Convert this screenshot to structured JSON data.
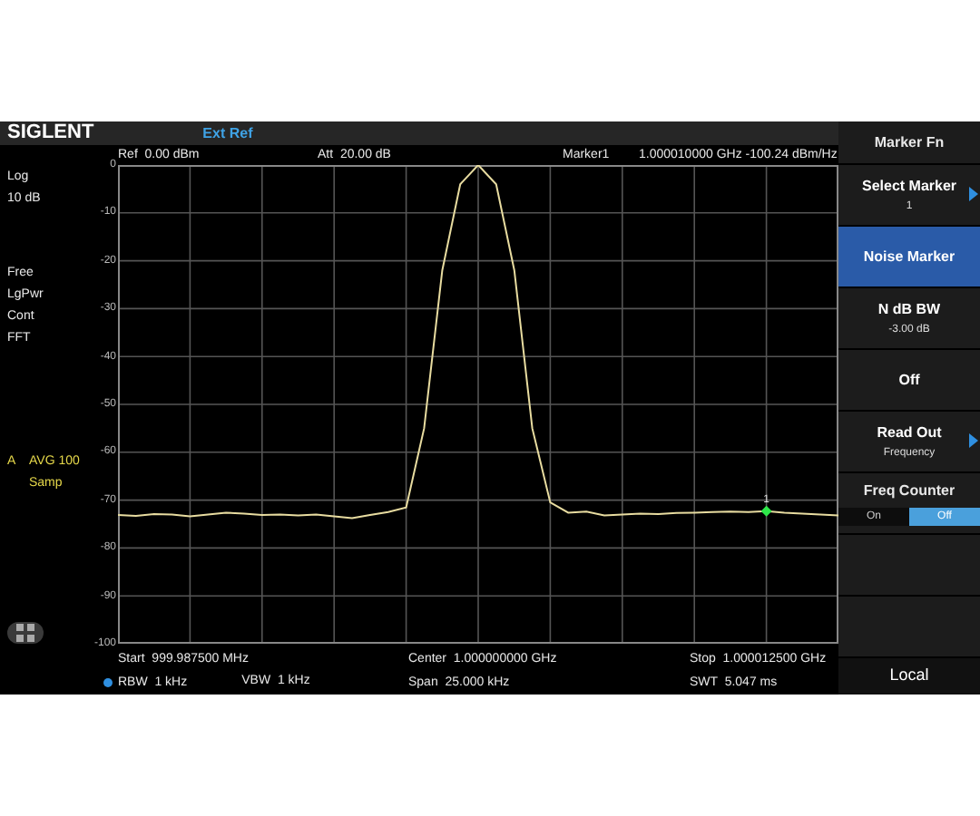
{
  "header": {
    "logo": "SIGLENT",
    "status": "Ext Ref"
  },
  "info": {
    "ref_label": "Ref",
    "ref": "0.00 dBm",
    "att_label": "Att",
    "att": "20.00 dB",
    "marker_label": "Marker1",
    "marker_readout": "1.000010000 GHz -100.24 dBm/Hz"
  },
  "left_panel": {
    "scale": [
      "Log",
      "10 dB"
    ],
    "modes": [
      "Free",
      "LgPwr",
      "Cont",
      "FFT"
    ],
    "trace": {
      "letter": "A",
      "mode": "AVG 100",
      "detector": "Samp"
    }
  },
  "plot": {
    "chart_data": {
      "type": "line",
      "grid": true,
      "ylim": [
        -100,
        0
      ],
      "yticks": [
        0,
        -10,
        -20,
        -30,
        -40,
        -50,
        -60,
        -70,
        -80,
        -90,
        -100
      ],
      "categories": [
        null,
        null,
        null,
        null,
        null,
        null,
        null,
        null,
        null,
        null,
        null,
        null,
        null,
        null,
        null,
        null,
        null,
        null,
        null,
        null,
        null,
        null,
        null,
        null,
        null,
        null,
        null,
        null,
        null,
        null,
        null,
        null,
        null,
        null,
        null,
        null,
        null,
        null,
        null,
        null,
        null
      ],
      "series": [
        {
          "color": "#e8dca0",
          "values": [
            -73.1,
            -73.3,
            -72.9,
            -73.0,
            -73.4,
            -73.0,
            -72.6,
            -72.8,
            -73.1,
            -73.0,
            -73.2,
            -73.0,
            -73.4,
            -73.8,
            -73.1,
            -72.5,
            -71.5,
            -55,
            -22,
            -4,
            0,
            -4,
            -22,
            -55,
            -70.5,
            -72.6,
            -72.4,
            -73.2,
            -73.0,
            -72.8,
            -72.9,
            -72.7,
            -72.6,
            -72.5,
            -72.4,
            -72.5,
            -72.3,
            -72.6,
            -72.8,
            -73.0,
            -73.2
          ]
        }
      ]
    }
  },
  "marker": {
    "label": "1"
  },
  "bottom": [
    {
      "label": "Start",
      "value": "999.987500 MHz"
    },
    {
      "label": "Center",
      "value": "1.000000000 GHz"
    },
    {
      "label": "Stop",
      "value": "1.000012500 GHz"
    },
    {
      "label": "RBW",
      "value": "1 kHz",
      "dot": true
    },
    {
      "label": "VBW",
      "value": "1 kHz"
    },
    {
      "label": "Span",
      "value": "25.000 kHz"
    },
    {
      "label": "SWT",
      "value": "5.047 ms"
    }
  ],
  "softkeys": [
    {
      "kind": "title",
      "label": "Marker Fn"
    },
    {
      "kind": "key",
      "label": "Select Marker",
      "value": "1",
      "submenu": true,
      "selected": false
    },
    {
      "kind": "key",
      "label": "Noise Marker",
      "submenu": false,
      "selected": true
    },
    {
      "kind": "key",
      "label": "N dB BW",
      "value": "-3.00 dB",
      "submenu": false,
      "selected": false
    },
    {
      "kind": "key",
      "label": "Off",
      "submenu": false,
      "selected": false
    },
    {
      "kind": "key",
      "label": "Read Out",
      "value": "Frequency",
      "submenu": true,
      "selected": false
    },
    {
      "kind": "toggle",
      "label": "Freq Counter",
      "options": [
        {
          "label": "On",
          "selected": false
        },
        {
          "label": "Off",
          "selected": true
        }
      ]
    }
  ],
  "footer": {
    "label": "Local"
  }
}
